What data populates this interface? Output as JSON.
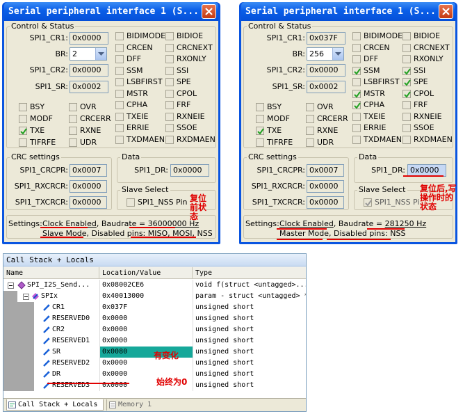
{
  "dialog1": {
    "title": "Serial peripheral interface 1 (S...",
    "control_status_title": "Control & Status",
    "cr1_label": "SPI1_CR1:",
    "cr1_value": "0x0000",
    "br_label": "BR:",
    "br_value": "2",
    "cr2_label": "SPI1_CR2:",
    "cr2_value": "0x0000",
    "sr_label": "SPI1_SR:",
    "sr_value": "0x0002",
    "checks": [
      {
        "label": "BIDIMODE",
        "checked": false
      },
      {
        "label": "BIDIOE",
        "checked": false
      },
      {
        "label": "CRCEN",
        "checked": false
      },
      {
        "label": "CRCNEXT",
        "checked": false
      },
      {
        "label": "DFF",
        "checked": false
      },
      {
        "label": "RXONLY",
        "checked": false
      },
      {
        "label": "SSM",
        "checked": false
      },
      {
        "label": "SSI",
        "checked": false
      },
      {
        "label": "LSBFIRST",
        "checked": false
      },
      {
        "label": "SPE",
        "checked": false
      },
      {
        "label": "MSTR",
        "checked": false
      },
      {
        "label": "CPOL",
        "checked": false
      },
      {
        "label": "CPHA",
        "checked": false
      },
      {
        "label": "FRF",
        "checked": false
      },
      {
        "label": "TXEIE",
        "checked": false
      },
      {
        "label": "RXNEIE",
        "checked": false
      },
      {
        "label": "ERRIE",
        "checked": false
      },
      {
        "label": "SSOE",
        "checked": false
      },
      {
        "label": "TXDMAEN",
        "checked": false
      },
      {
        "label": "RXDMAEN",
        "checked": false
      }
    ],
    "status_checks": [
      {
        "label": "BSY",
        "checked": false
      },
      {
        "label": "OVR",
        "checked": false
      },
      {
        "label": "MODF",
        "checked": false
      },
      {
        "label": "CRCERR",
        "checked": false
      },
      {
        "label": "TXE",
        "checked": true
      },
      {
        "label": "RXNE",
        "checked": false
      },
      {
        "label": "TIFRFE",
        "checked": false
      },
      {
        "label": "UDR",
        "checked": false
      }
    ],
    "crc_title": "CRC settings",
    "crcpr_label": "SPI1_CRCPR:",
    "crcpr_value": "0x0007",
    "rxcrcr_label": "SPI1_RXCRCR:",
    "rxcrcr_value": "0x0000",
    "txcrcr_label": "SPI1_TXCRCR:",
    "txcrcr_value": "0x0000",
    "data_title": "Data",
    "dr_label": "SPI1_DR:",
    "dr_value": "0x0000",
    "slave_title": "Slave Select",
    "nss_label": "SPI1_NSS Pin",
    "settings_label": "Settings:",
    "settings_1a": "Clock Enabled",
    "settings_1b": ", Baudrate = ",
    "settings_1c": "36000000 Hz",
    "settings_2a": "Slave Mode",
    "settings_2b": ", Disabled pins: ",
    "settings_2c": "MISO, MOSI, NSS",
    "annotation": [
      "复位",
      "前状",
      "态"
    ]
  },
  "dialog2": {
    "title": "Serial peripheral interface 1 (S...",
    "control_status_title": "Control & Status",
    "cr1_label": "SPI1_CR1:",
    "cr1_value": "0x037F",
    "br_label": "BR:",
    "br_value": "256",
    "cr2_label": "SPI1_CR2:",
    "cr2_value": "0x0000",
    "sr_label": "SPI1_SR:",
    "sr_value": "0x0002",
    "checks": [
      {
        "label": "BIDIMODE",
        "checked": false
      },
      {
        "label": "BIDIOE",
        "checked": false
      },
      {
        "label": "CRCEN",
        "checked": false
      },
      {
        "label": "CRCNEXT",
        "checked": false
      },
      {
        "label": "DFF",
        "checked": false
      },
      {
        "label": "RXONLY",
        "checked": false
      },
      {
        "label": "SSM",
        "checked": true
      },
      {
        "label": "SSI",
        "checked": true
      },
      {
        "label": "LSBFIRST",
        "checked": false
      },
      {
        "label": "SPE",
        "checked": true
      },
      {
        "label": "MSTR",
        "checked": true
      },
      {
        "label": "CPOL",
        "checked": true
      },
      {
        "label": "CPHA",
        "checked": true
      },
      {
        "label": "FRF",
        "checked": false
      },
      {
        "label": "TXEIE",
        "checked": false
      },
      {
        "label": "RXNEIE",
        "checked": false
      },
      {
        "label": "ERRIE",
        "checked": false
      },
      {
        "label": "SSOE",
        "checked": false
      },
      {
        "label": "TXDMAEN",
        "checked": false
      },
      {
        "label": "RXDMAEN",
        "checked": false
      }
    ],
    "status_checks": [
      {
        "label": "BSY",
        "checked": false
      },
      {
        "label": "OVR",
        "checked": false
      },
      {
        "label": "MODF",
        "checked": false
      },
      {
        "label": "CRCERR",
        "checked": false
      },
      {
        "label": "TXE",
        "checked": true
      },
      {
        "label": "RXNE",
        "checked": false
      },
      {
        "label": "TIFRFE",
        "checked": false
      },
      {
        "label": "UDR",
        "checked": false
      }
    ],
    "crc_title": "CRC settings",
    "crcpr_label": "SPI1_CRCPR:",
    "crcpr_value": "0x0007",
    "rxcrcr_label": "SPI1_RXCRCR:",
    "rxcrcr_value": "0x0000",
    "txcrcr_label": "SPI1_TXCRCR:",
    "txcrcr_value": "0x0000",
    "data_title": "Data",
    "dr_label": "SPI1_DR:",
    "dr_value": "0x0000",
    "slave_title": "Slave Select",
    "nss_label": "SPI1_NSS Pi",
    "settings_label": "Settings:",
    "settings_1a": "Clock Enabled",
    "settings_1b": ", Baudrate = ",
    "settings_1c": "281250 Hz",
    "settings_2a": "Master Mode",
    "settings_2b": ", ",
    "settings_2c": "Disabled pins: NSS",
    "annotation": [
      "复位后,写",
      "操作时的",
      "状态"
    ]
  },
  "callstack": {
    "title": "Call Stack + Locals",
    "headers": [
      "Name",
      "Location/Value",
      "Type"
    ],
    "rows": [
      {
        "name": "SPI_I2S_Send...",
        "value": "0x08002CE6",
        "type": "void f(struct <untagged>..."
      },
      {
        "name": "SPIx",
        "value": "0x40013000",
        "type": "param - struct <untagged> *"
      },
      {
        "name": "CR1",
        "value": "0x037F",
        "type": "unsigned short"
      },
      {
        "name": "RESERVED0",
        "value": "0x0000",
        "type": "unsigned short"
      },
      {
        "name": "CR2",
        "value": "0x0000",
        "type": "unsigned short"
      },
      {
        "name": "RESERVED1",
        "value": "0x0000",
        "type": "unsigned short"
      },
      {
        "name": "SR",
        "value": "0x0080",
        "type": "unsigned short"
      },
      {
        "name": "RESERVED2",
        "value": "0x0000",
        "type": "unsigned short"
      },
      {
        "name": "DR",
        "value": "0x0000",
        "type": "unsigned short"
      },
      {
        "name": "RESERVED3",
        "value": "0x0000",
        "type": "unsigned short"
      }
    ],
    "tab_active": "Call Stack + Locals",
    "tab_inactive": "Memory 1",
    "annotation_changed": "有变化",
    "annotation_zero": "始终为0"
  },
  "colors": {
    "title_blue": "#0a55e0",
    "dialog_bg": "#ece9d8",
    "annotation_red": "#e00000",
    "selected_cell": "#16a89a"
  }
}
